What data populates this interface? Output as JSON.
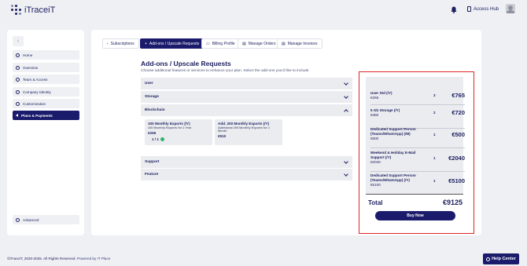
{
  "app": {
    "logo_text": "iTraceiT"
  },
  "header": {
    "access_hub": "Access Hub"
  },
  "sidebar": {
    "items": [
      {
        "label": "Home",
        "icon": "home-icon"
      },
      {
        "label": "Overview",
        "icon": "overview-icon"
      },
      {
        "label": "Team & Access",
        "icon": "team-icon"
      },
      {
        "label": "Company Identity",
        "icon": "company-icon"
      },
      {
        "label": "Customization",
        "icon": "customization-icon"
      },
      {
        "label": "Plans & Payments",
        "icon": "back-arrow-icon",
        "active": true
      }
    ],
    "advanced": "Advanced"
  },
  "tabs": [
    {
      "label": "Subscriptions",
      "icon": "back-chevron-icon"
    },
    {
      "label": "Add-ons / Upscale Requests",
      "icon": "plus-icon",
      "active": true
    },
    {
      "label": "Billing Profile",
      "icon": "billing-icon"
    },
    {
      "label": "Manage Orders",
      "icon": "orders-icon"
    },
    {
      "label": "Manage Invoices",
      "icon": "invoices-icon"
    }
  ],
  "page": {
    "title": "Add-ons / Upscale Requests",
    "subtitle": "Choose additional features or services to enhance your plan. Select the add-ons you'd like to include"
  },
  "sections": {
    "user": "User",
    "storage": "Storage",
    "blockchain": "Blockchain",
    "support": "Support",
    "feature": "Feature"
  },
  "blockchain_cards": [
    {
      "title": "100 Monthly Exports (/Y)",
      "sub": "100 Monthly Exports for 1 Year",
      "price": "€255",
      "qty": "1 / 1"
    },
    {
      "title": "Add. 200 Monthly Exports (/Y)",
      "sub": "Additional 200 Monthly Exports for 1 Month",
      "price": "€510"
    }
  ],
  "summary": {
    "rows": [
      {
        "name": "User Std (/Y)",
        "price": "€255",
        "qty": "3",
        "amount": "€765"
      },
      {
        "name": "5 Gb Storage (/Y)",
        "price": "€360",
        "qty": "2",
        "amount": "€720"
      },
      {
        "name": "Dedicated Support Person (Teams/WhatsApp) (/M)",
        "price": "€500",
        "qty": "1",
        "amount": "€500"
      },
      {
        "name": "Weekend & Holiday E-Mail Support (/Y)",
        "price": "€2040",
        "qty": "1",
        "amount": "€2040"
      },
      {
        "name": "Dedicated Support Person (Teams/WhatsApp) (/Y)",
        "price": "€5100",
        "qty": "1",
        "amount": "€5100"
      }
    ],
    "total_label": "Total",
    "total_amount": "€9125",
    "buy_label": "Buy Now"
  },
  "footer": {
    "copyright": "©iTraceiT, 2020-2025. All Rights Reserved.",
    "powered": "Powered by IT Place"
  },
  "help": {
    "label": "Help Center"
  },
  "colors": {
    "primary": "#1a1b6b",
    "highlight_border": "#e02424",
    "success": "#2fb56a"
  }
}
